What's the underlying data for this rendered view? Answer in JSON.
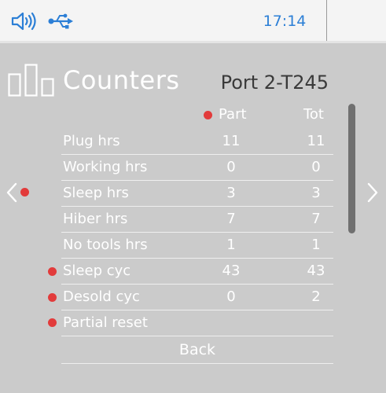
{
  "status": {
    "time": "17:14"
  },
  "header": {
    "title": "Counters",
    "port": "Port 2-T245"
  },
  "columns": {
    "part": "Part",
    "tot": "Tot"
  },
  "rows": [
    {
      "label": "Plug hrs",
      "part": "11",
      "tot": "11",
      "marked": false
    },
    {
      "label": "Working hrs",
      "part": "0",
      "tot": "0",
      "marked": false
    },
    {
      "label": "Sleep hrs",
      "part": "3",
      "tot": "3",
      "marked": false
    },
    {
      "label": "Hiber hrs",
      "part": "7",
      "tot": "7",
      "marked": false
    },
    {
      "label": "No tools hrs",
      "part": "1",
      "tot": "1",
      "marked": false
    },
    {
      "label": "Sleep cyc",
      "part": "43",
      "tot": "43",
      "marked": true
    },
    {
      "label": "Desold cyc",
      "part": "0",
      "tot": "2",
      "marked": true
    },
    {
      "label": "Partial reset",
      "part": "",
      "tot": "",
      "marked": true
    }
  ],
  "back_label": "Back",
  "icons": {
    "speaker": "speaker-icon",
    "usb": "usb-icon",
    "counters": "bar-chart-icon",
    "prev": "chevron-left-icon",
    "next": "chevron-right-icon"
  },
  "colors": {
    "accent": "#2c7fd6",
    "marker": "#e23b3b",
    "panel": "#cbcbcb",
    "statusbar": "#f4f4f4"
  }
}
